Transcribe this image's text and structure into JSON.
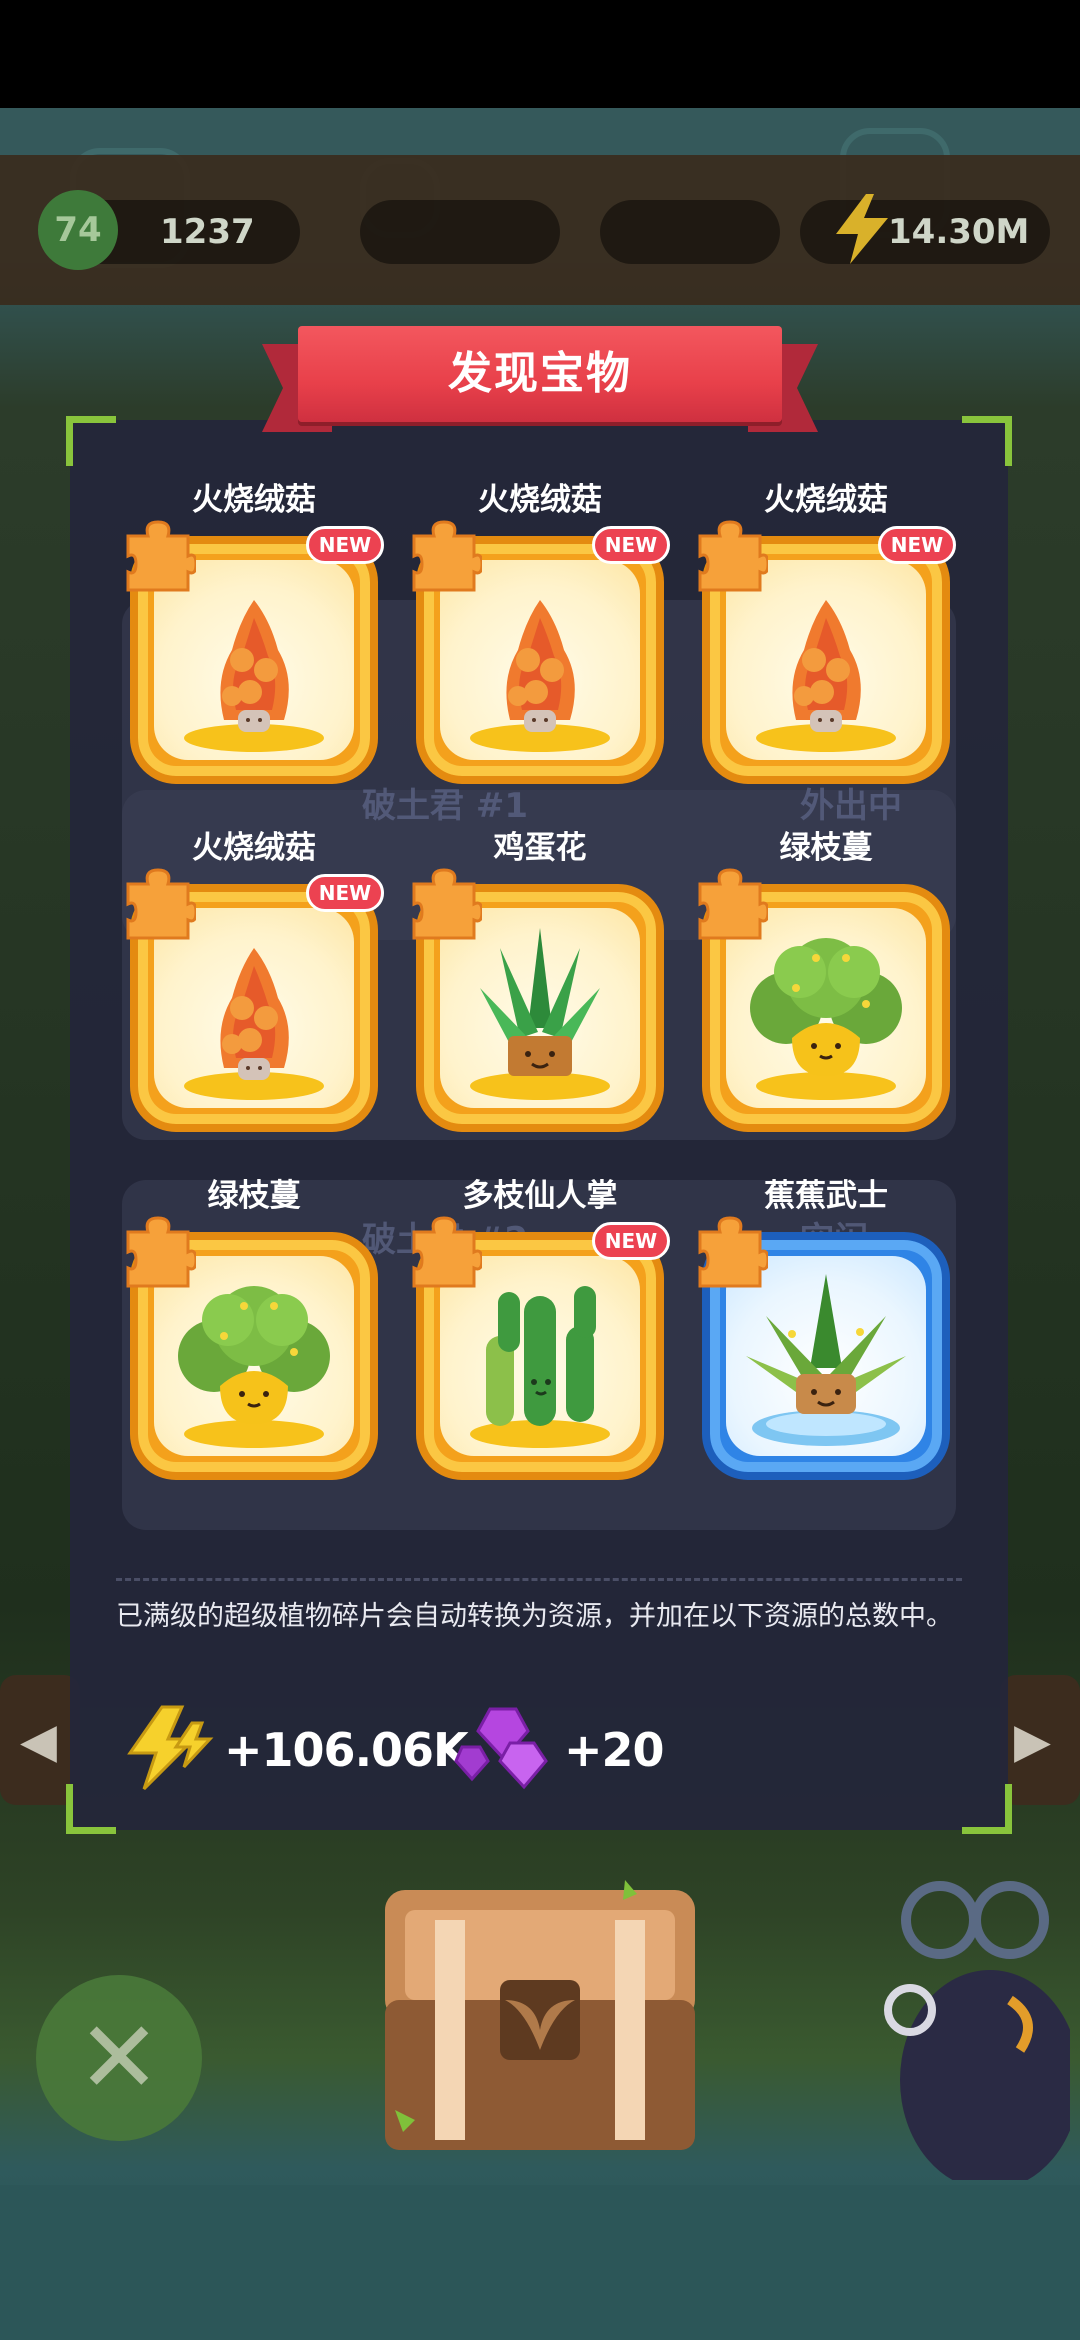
{
  "hud": {
    "level": "74",
    "coins": "1237",
    "energy": "14.30M"
  },
  "dialog": {
    "title": "发现宝物",
    "ghost_labels": [
      "破土君 #1",
      "外出中",
      "破土君 #2",
      "空闲"
    ],
    "cards": [
      {
        "name": "火烧绒菇",
        "plant": "morel-mushroom",
        "is_new": true,
        "rarity": "gold"
      },
      {
        "name": "火烧绒菇",
        "plant": "morel-mushroom",
        "is_new": true,
        "rarity": "gold"
      },
      {
        "name": "火烧绒菇",
        "plant": "morel-mushroom",
        "is_new": true,
        "rarity": "gold"
      },
      {
        "name": "火烧绒菇",
        "plant": "morel-mushroom",
        "is_new": true,
        "rarity": "gold"
      },
      {
        "name": "鸡蛋花",
        "plant": "spiky-succulent",
        "is_new": false,
        "rarity": "gold"
      },
      {
        "name": "绿枝蔓",
        "plant": "leafy-bush",
        "is_new": false,
        "rarity": "gold"
      },
      {
        "name": "绿枝蔓",
        "plant": "leafy-bush",
        "is_new": false,
        "rarity": "gold"
      },
      {
        "name": "多枝仙人掌",
        "plant": "cactus",
        "is_new": true,
        "rarity": "gold"
      },
      {
        "name": "蕉蕉武士",
        "plant": "agave-warrior",
        "is_new": false,
        "rarity": "blue"
      }
    ],
    "new_badge": "NEW",
    "info_text": "已满级的超级植物碎片会自动转换为资源，并加在以下资源的总数中。",
    "rewards": [
      {
        "icon": "lightning-energy-icon",
        "value": "+106.06K"
      },
      {
        "icon": "purple-gem-icon",
        "value": "+20"
      }
    ]
  },
  "colors": {
    "gold_tile": "#f4a11c",
    "blue_tile": "#2f84e6",
    "ribbon": "#e8404a",
    "frame_corner": "#89c43c",
    "new_badge": "#ec4251"
  }
}
